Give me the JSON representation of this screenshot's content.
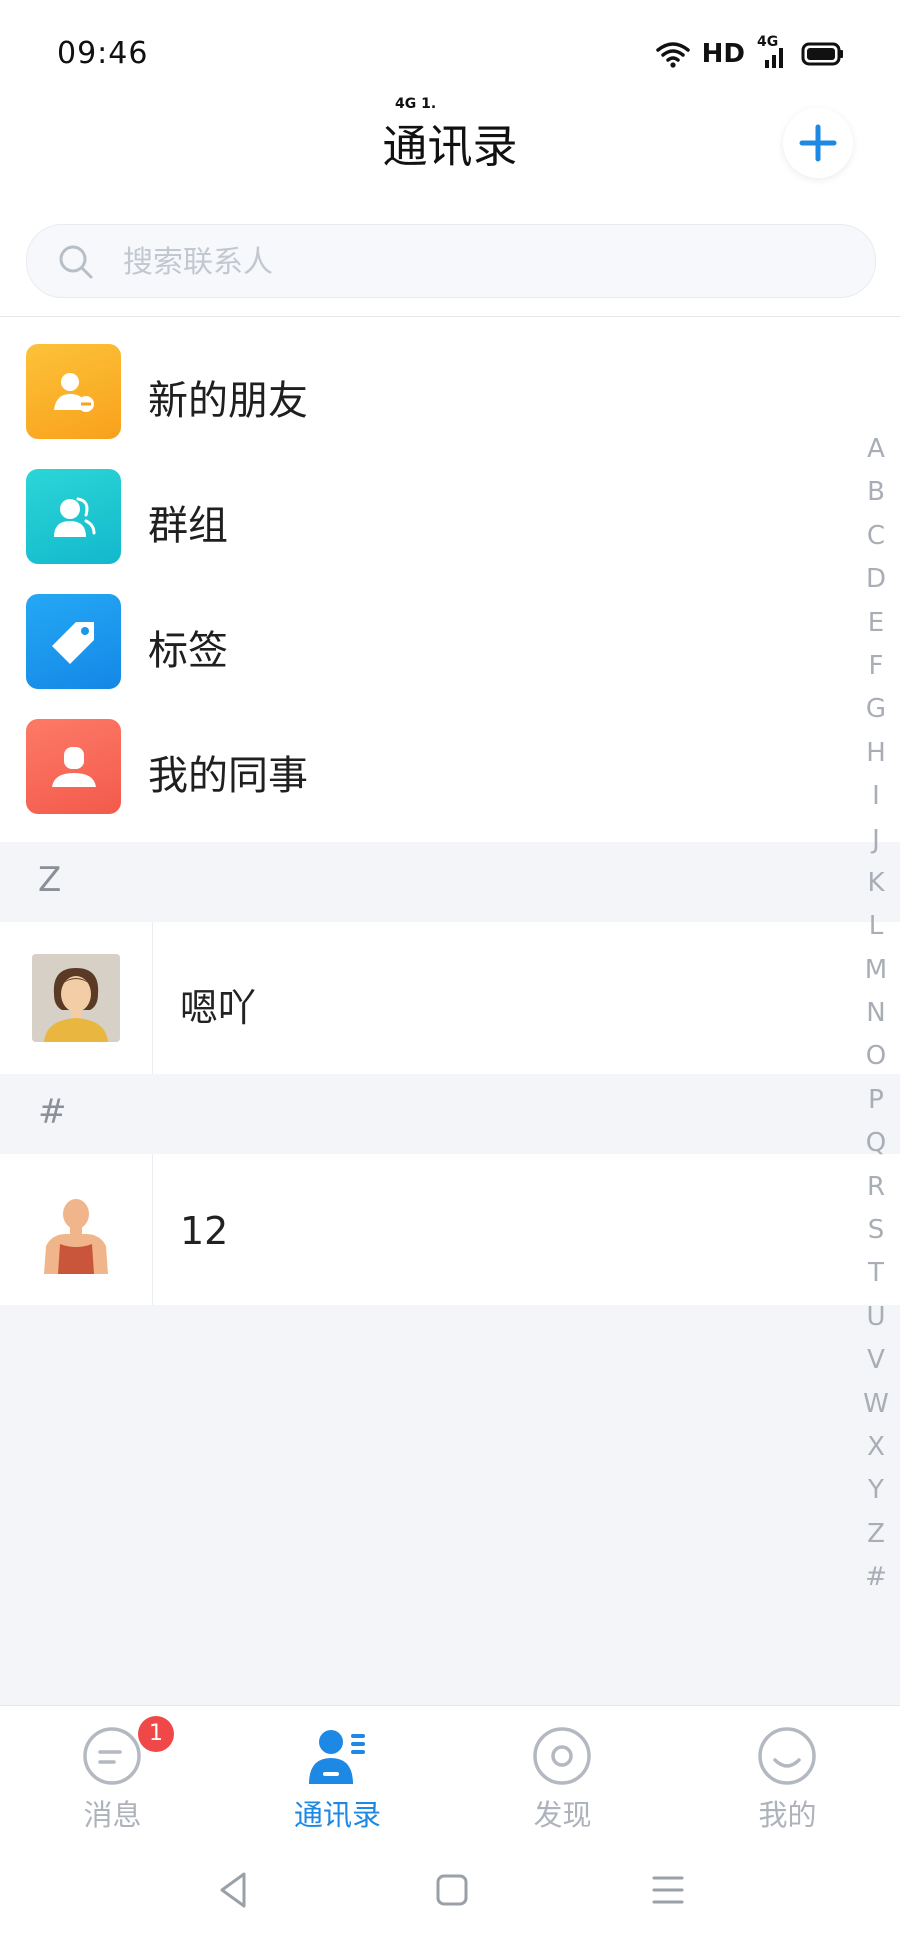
{
  "status_bar": {
    "time": "09:46",
    "network_label": "HD",
    "cell_label": "4G"
  },
  "header": {
    "title": "通讯录",
    "ghost_text": "4G  1.",
    "add_icon": "plus-icon"
  },
  "search": {
    "placeholder": "搜索联系人",
    "value": ""
  },
  "features": [
    {
      "label": "新的朋友",
      "icon": "new-friend-icon",
      "color": "#fbb22a"
    },
    {
      "label": "群组",
      "icon": "group-icon",
      "color": "#1ccad0"
    },
    {
      "label": "标签",
      "icon": "tag-icon",
      "color": "#1e9cf0"
    },
    {
      "label": "我的同事",
      "icon": "colleague-icon",
      "color": "#fb6a5a"
    }
  ],
  "sections": [
    {
      "letter": "Z",
      "contacts": [
        {
          "name": "嗯吖"
        }
      ]
    },
    {
      "letter": "#",
      "contacts": [
        {
          "name": "12"
        }
      ]
    }
  ],
  "index_letters": [
    "A",
    "B",
    "C",
    "D",
    "E",
    "F",
    "G",
    "H",
    "I",
    "J",
    "K",
    "L",
    "M",
    "N",
    "O",
    "P",
    "Q",
    "R",
    "S",
    "T",
    "U",
    "V",
    "W",
    "X",
    "Y",
    "Z",
    "#"
  ],
  "bottom_nav": {
    "tabs": [
      {
        "label": "消息",
        "icon": "message-icon",
        "badge": "1"
      },
      {
        "label": "通讯录",
        "icon": "contacts-icon",
        "active": true
      },
      {
        "label": "发现",
        "icon": "discover-icon"
      },
      {
        "label": "我的",
        "icon": "profile-icon"
      }
    ]
  },
  "colors": {
    "accent": "#1e88e5",
    "badge": "#f04848",
    "section_bg": "#f3f5f8"
  }
}
